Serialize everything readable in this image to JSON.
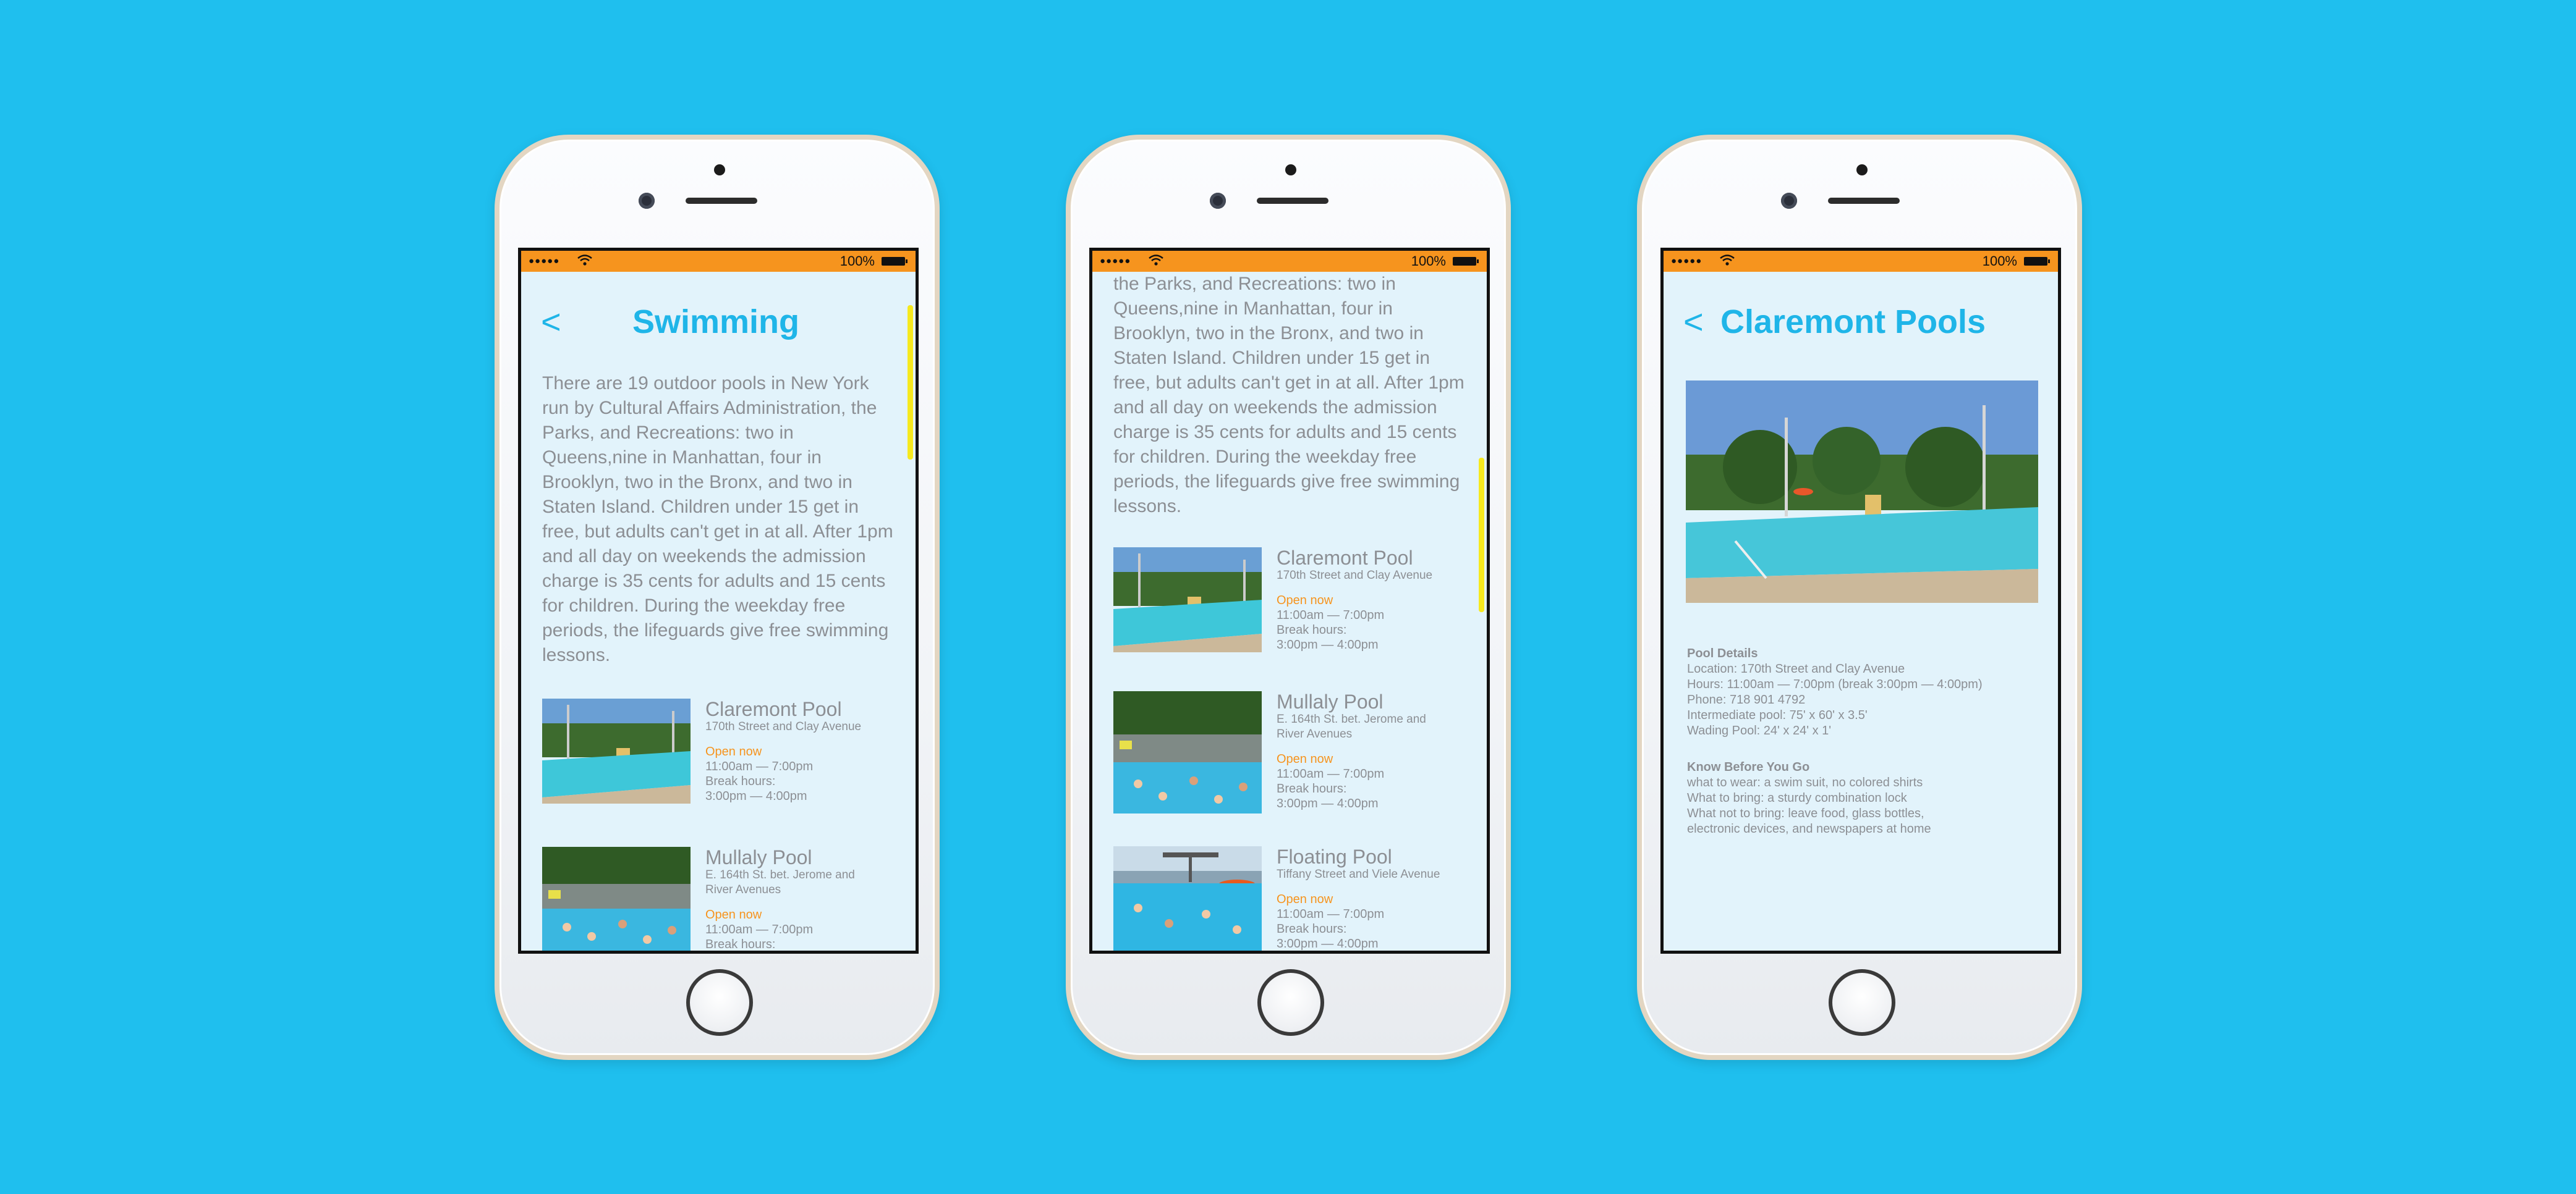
{
  "colors": {
    "background": "#1fbfee",
    "status_bar": "#f6941e",
    "accent": "#1fb5e8",
    "open_label": "#f6941e",
    "scroll_indicator": "#f6e91e"
  },
  "status_bar": {
    "battery_percent": "100%"
  },
  "list_screen": {
    "back_label": "<",
    "title": "Swimming",
    "intro": "There are 19 outdoor pools in New York run by Cultural Affairs Administration, the Parks, and Recreations: two in Queens,nine in Manhattan, four in Brooklyn, two in the Bronx, and two in Staten Island. Children under 15 get in free, but adults can't get in at all. After 1pm and all day on weekends  the admission charge is 35 cents for adults and 15 cents for children. During the weekday free periods, the lifeguards give free swimming lessons."
  },
  "scrolled_screen": {
    "intro_tail": "the Parks, and Recreations: two in Queens,nine in Manhattan, four in Brooklyn, two in the Bronx, and two in Staten Island. Children under 15 get in free, but adults can't get in at all. After 1pm and all day on weekends  the admission charge is 35 cents for adults and 15 cents for children. During the weekday free periods, the lifeguards give free swimming lessons."
  },
  "pools": [
    {
      "name": "Claremont Pool",
      "address": "170th Street and Clay Avenue",
      "status": "Open now",
      "hours": "11:00am — 7:00pm",
      "break_label": "Break hours:",
      "break_hours": "3:00pm — 4:00pm"
    },
    {
      "name": "Mullaly Pool",
      "address_line1": "E. 164th St. bet. Jerome and",
      "address_line2": "River Avenues",
      "status": "Open now",
      "hours": "11:00am — 7:00pm",
      "break_label": "Break hours:",
      "break_hours": "3:00pm — 4:00pm"
    },
    {
      "name": "Floating Pool",
      "address": "Tiffany Street and Viele Avenue",
      "status": "Open now",
      "hours": "11:00am — 7:00pm",
      "break_label": "Break hours:",
      "break_hours": "3:00pm — 4:00pm"
    }
  ],
  "detail_screen": {
    "back_label": "<",
    "title": "Claremont Pools",
    "details_heading": "Pool Details",
    "details": [
      "Location: 170th Street and Clay Avenue",
      "Hours: 11:00am — 7:00pm (break 3:00pm — 4:00pm)",
      "Phone: 718 901 4792",
      "Intermediate pool: 75' x 60' x 3.5'",
      "Wading Pool: 24' x 24' x 1'"
    ],
    "know_heading": "Know Before You Go",
    "know": [
      "what to wear: a swim suit, no colored shirts",
      "What to bring: a sturdy combination lock",
      "What not to bring: leave food, glass bottles,",
      "electronic devices, and newspapers at home"
    ]
  }
}
